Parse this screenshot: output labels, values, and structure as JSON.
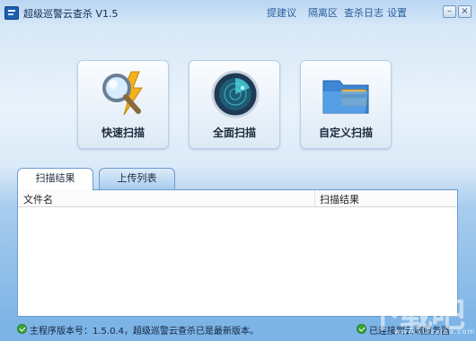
{
  "window": {
    "title": "超级巡警云查杀 V1.5",
    "nav": [
      "提建议",
      "隔离区",
      "查杀日志",
      "设置"
    ],
    "controls": {
      "minimize": "–",
      "close": "×"
    }
  },
  "actions": [
    {
      "label": "快速扫描",
      "icon": "magnifier-lightning-icon"
    },
    {
      "label": "全面扫描",
      "icon": "radar-icon"
    },
    {
      "label": "自定义扫描",
      "icon": "folder-card-icon"
    }
  ],
  "tabs": [
    {
      "label": "扫描结果",
      "active": true
    },
    {
      "label": "上传列表",
      "active": false
    }
  ],
  "table": {
    "columns": [
      "文件名",
      "扫描结果"
    ],
    "rows": []
  },
  "status": {
    "version_text": "主程序版本号：1.5.0.4，超级巡警云查杀已是最新版本。",
    "cloud_text": "已连接到云端服务器"
  },
  "watermark": {
    "logo": "下载吧",
    "url": "www.xiazaiba.com"
  },
  "colors": {
    "accent": "#2a5e9c",
    "ok_green": "#3aa63a",
    "frame": "#6c9cd0"
  }
}
